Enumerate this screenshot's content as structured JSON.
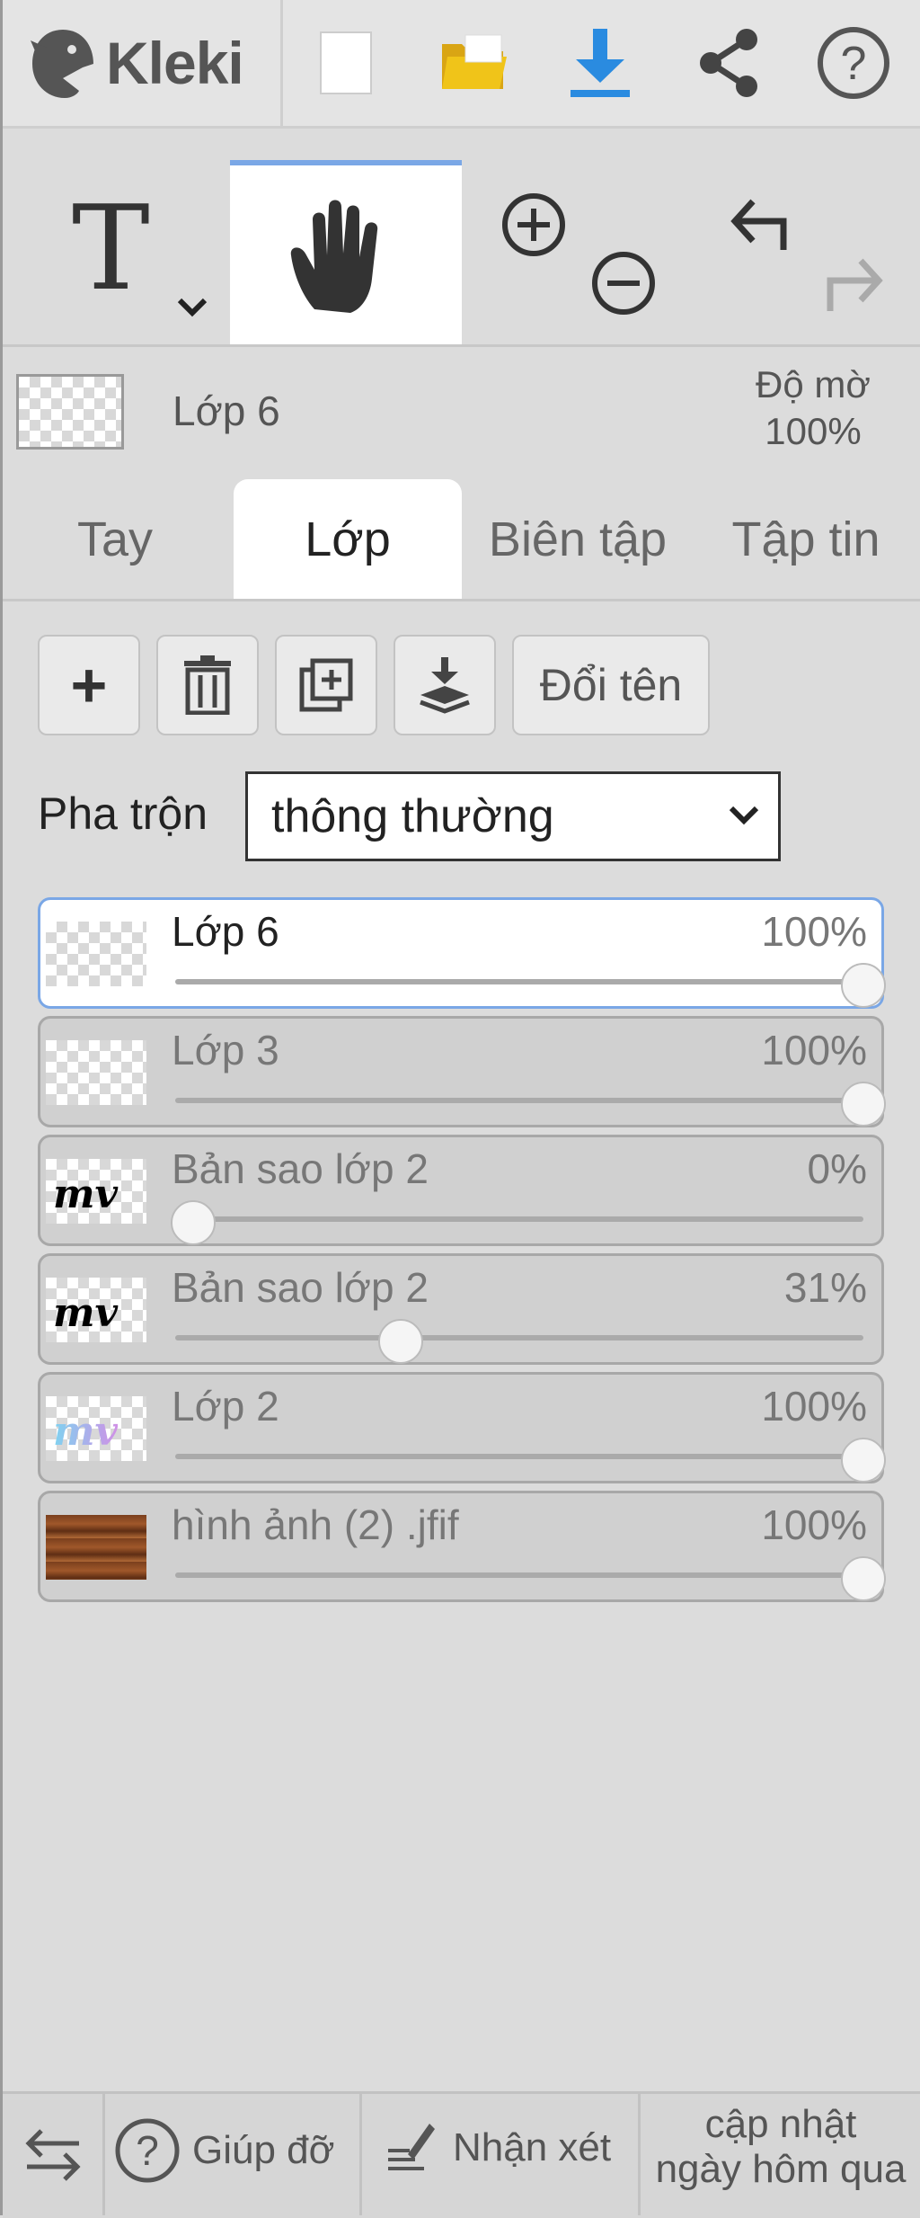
{
  "app": {
    "name": "Kleki"
  },
  "toolbar": {
    "icons": [
      "new-document-icon",
      "open-folder-icon",
      "download-icon",
      "share-icon",
      "help-icon"
    ],
    "colors": {
      "folder": "#f0c419",
      "download": "#2a8be0"
    }
  },
  "tools": {
    "text_tool_glyph": "T",
    "hand_tool_active": true,
    "zoom_in": "zoom-in-icon",
    "zoom_out": "zoom-out-icon",
    "undo": "undo-icon",
    "redo": "redo-icon"
  },
  "current_layer": {
    "name": "Lớp 6",
    "opacity_label": "Độ mờ",
    "opacity_value": "100%"
  },
  "tabs": [
    {
      "label": "Tay",
      "active": false
    },
    {
      "label": "Lớp",
      "active": true
    },
    {
      "label": "Biên tập",
      "active": false
    },
    {
      "label": "Tập tin",
      "active": false
    }
  ],
  "layer_actions": {
    "add": "+",
    "rename_label": "Đổi tên"
  },
  "blend": {
    "label": "Pha trộn",
    "value": "thông thường"
  },
  "layers": [
    {
      "name": "Lớp 6",
      "opacity": "100%",
      "value": 1.0,
      "selected": true,
      "thumb": "transparent"
    },
    {
      "name": "Lớp 3",
      "opacity": "100%",
      "value": 1.0,
      "selected": false,
      "thumb": "transparent"
    },
    {
      "name": "Bản sao lớp 2",
      "opacity": "0%",
      "value": 0.0,
      "selected": false,
      "thumb": "mv-black"
    },
    {
      "name": "Bản sao lớp 2",
      "opacity": "31%",
      "value": 0.31,
      "selected": false,
      "thumb": "mv-black"
    },
    {
      "name": "Lớp 2",
      "opacity": "100%",
      "value": 1.0,
      "selected": false,
      "thumb": "mv-gradient"
    },
    {
      "name": "hình ảnh (2) .jfif",
      "opacity": "100%",
      "value": 1.0,
      "selected": false,
      "thumb": "wood"
    }
  ],
  "layer_thumb_text": "mv",
  "footer": {
    "swap_icon": "swap-arrows-icon",
    "help_label": "Giúp đỡ",
    "feedback_label": "Nhận xét",
    "update_line1": "cập nhật",
    "update_line2": "ngày hôm qua"
  }
}
